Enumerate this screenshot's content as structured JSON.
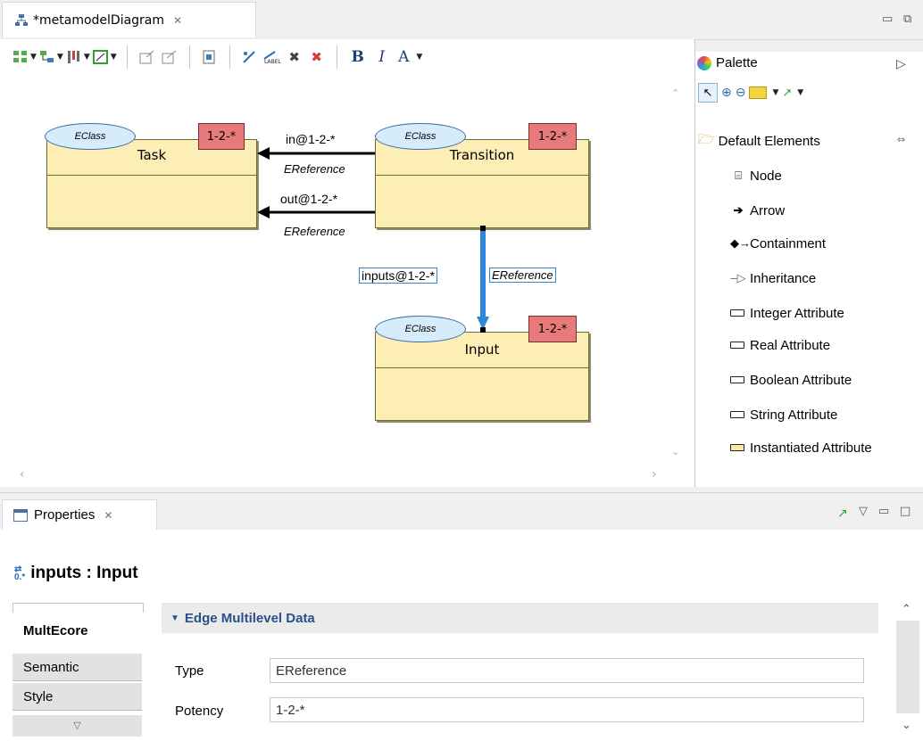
{
  "editor": {
    "tab_title": "*metamodelDiagram",
    "toolbar": {
      "bold": "B",
      "italic": "I",
      "font_color": "A"
    }
  },
  "diagram": {
    "nodes": [
      {
        "name": "Task",
        "stereotype": "EClass",
        "potency": "1-2-*"
      },
      {
        "name": "Transition",
        "stereotype": "EClass",
        "potency": "1-2-*"
      },
      {
        "name": "Input",
        "stereotype": "EClass",
        "potency": "1-2-*"
      }
    ],
    "edges": [
      {
        "label": "in@1-2-*",
        "type": "EReference"
      },
      {
        "label": "out@1-2-*",
        "type": "EReference"
      },
      {
        "label": "inputs@1-2-*",
        "type": "EReference"
      }
    ]
  },
  "palette": {
    "title": "Palette",
    "group": "Default Elements",
    "items": [
      "Node",
      "Arrow",
      "Containment",
      "Inheritance",
      "Integer Attribute",
      "Real Attribute",
      "Boolean Attribute",
      "String Attribute",
      "Instantiated Attribute"
    ]
  },
  "properties": {
    "tab_title": "Properties",
    "selection_title": "inputs : Input",
    "side_tabs": [
      "MultEcore",
      "Semantic",
      "Style"
    ],
    "section_title": "Edge Multilevel Data",
    "fields": [
      {
        "label": "Type",
        "value": "EReference"
      },
      {
        "label": "Potency",
        "value": "1-2-*"
      }
    ]
  },
  "colors": {
    "eclass_fill": "#fceeb5",
    "ellipse_fill": "#d7ecfb",
    "potency_fill": "#e77b7b",
    "selection_blue": "#2f86d8",
    "section_title": "#2a4f8a"
  }
}
